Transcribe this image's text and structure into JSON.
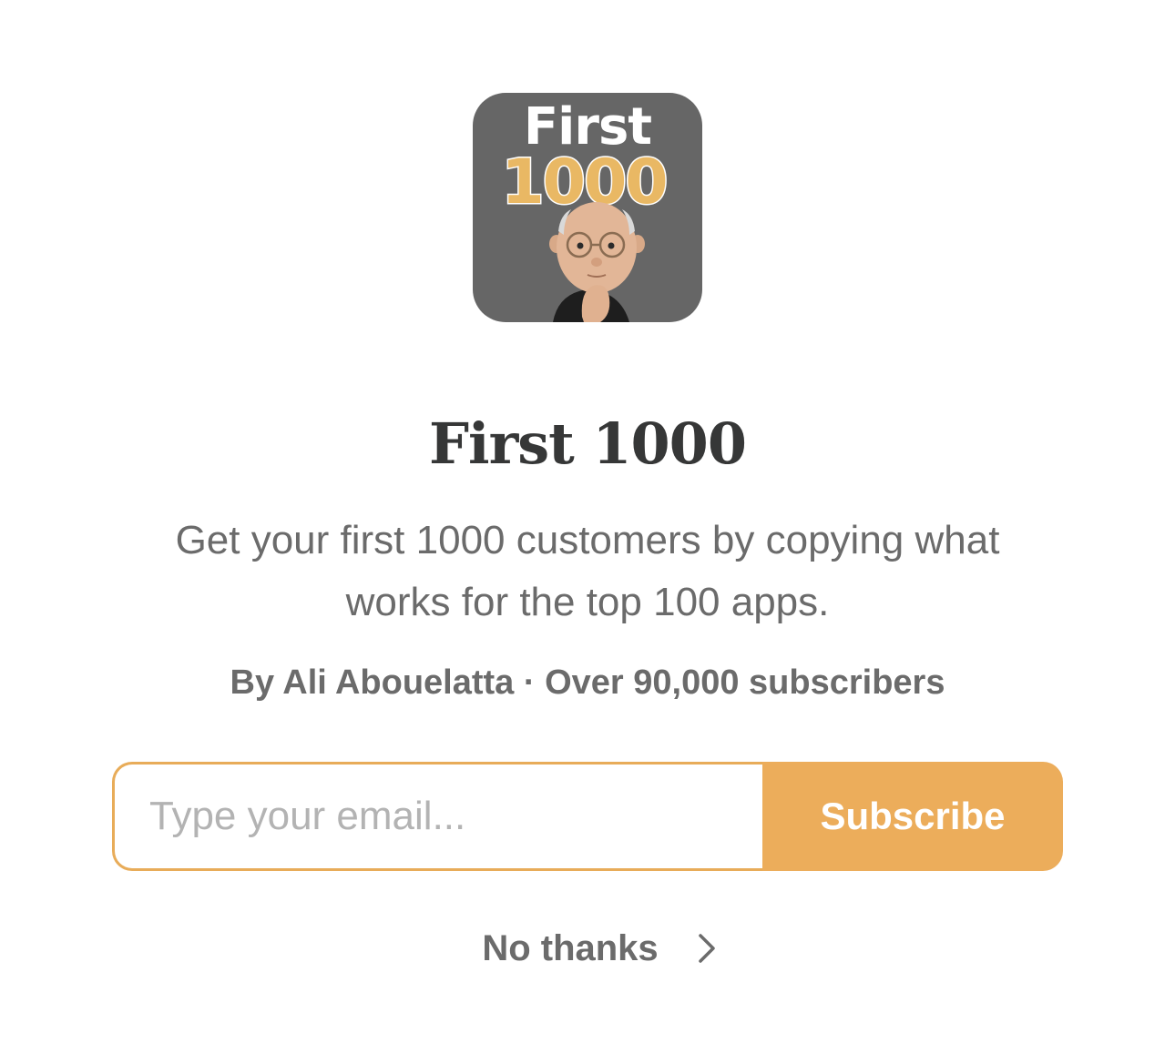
{
  "logo": {
    "line1": "First",
    "line2": "1000",
    "background": "#666666",
    "line1_color": "#ffffff",
    "line2_color": "#e9b864"
  },
  "publication": {
    "title": "First 1000",
    "description": "Get your first 1000 customers by copying what works for the top 100 apps.",
    "byline": "By Ali Abouelatta · Over 90,000 subscribers"
  },
  "form": {
    "email_value": "",
    "email_placeholder": "Type your email...",
    "subscribe_label": "Subscribe"
  },
  "no_thanks": {
    "label": "No thanks",
    "icon": "chevron-right-icon"
  },
  "colors": {
    "accent": "#ecad5b",
    "title": "#363737",
    "text": "#6b6b6b",
    "placeholder": "#b3b3b3"
  }
}
